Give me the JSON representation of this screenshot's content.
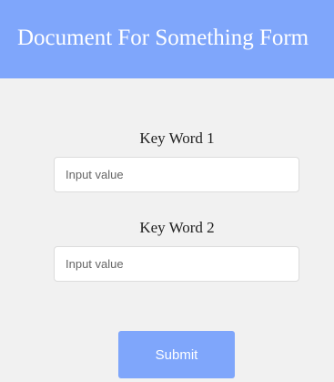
{
  "header": {
    "title": "Document For Something Form"
  },
  "form": {
    "fields": [
      {
        "label": "Key Word 1",
        "placeholder": "Input value",
        "value": ""
      },
      {
        "label": "Key Word 2",
        "placeholder": "Input value",
        "value": ""
      }
    ],
    "submit_label": "Submit"
  },
  "colors": {
    "accent": "#7fa6fb",
    "background": "#f1f1f1",
    "input_background": "#ffffff",
    "input_border": "#dcdcdc",
    "header_text": "#ffffff"
  }
}
